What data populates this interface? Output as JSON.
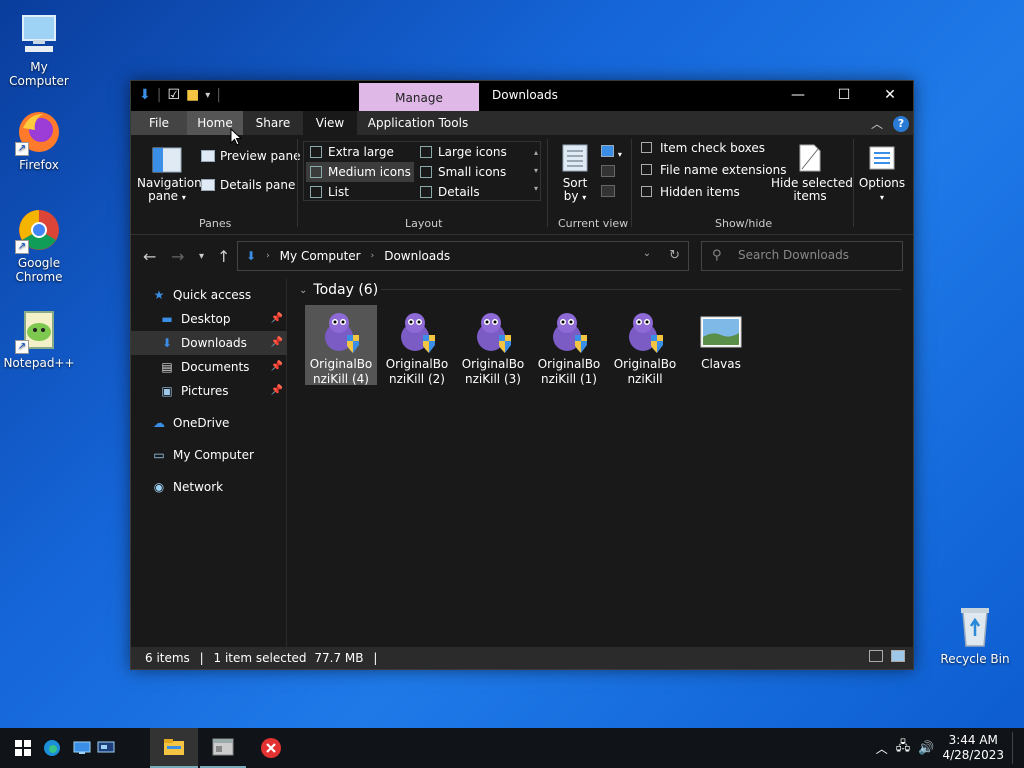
{
  "desktop": {
    "icons": [
      {
        "label": "My Computer"
      },
      {
        "label": "Firefox"
      },
      {
        "label": "Google Chrome"
      },
      {
        "label": "Notepad++"
      },
      {
        "label": "Recycle Bin"
      }
    ]
  },
  "window": {
    "title": "Downloads",
    "manage_tab": "Manage",
    "tabs": {
      "file": "File",
      "home": "Home",
      "share": "Share",
      "view": "View",
      "application_tools": "Application Tools"
    },
    "ribbon": {
      "panes": {
        "navigation_pane_line1": "Navigation",
        "navigation_pane_line2": "pane",
        "preview_pane": "Preview pane",
        "details_pane": "Details pane",
        "label": "Panes"
      },
      "layout": {
        "extra_large_icons": "Extra large icons",
        "large_icons": "Large icons",
        "medium_icons": "Medium icons",
        "small_icons": "Small icons",
        "list": "List",
        "details": "Details",
        "label": "Layout"
      },
      "current_view": {
        "sort_by_line1": "Sort",
        "sort_by_line2": "by",
        "label": "Current view"
      },
      "show_hide": {
        "item_check_boxes": "Item check boxes",
        "file_name_extensions": "File name extensions",
        "hidden_items": "Hidden items",
        "hide_selected_line1": "Hide selected",
        "hide_selected_line2": "items",
        "label": "Show/hide"
      },
      "options": "Options"
    },
    "address": {
      "crumbs": [
        "My Computer",
        "Downloads"
      ]
    },
    "search": {
      "placeholder": "Search Downloads"
    },
    "nav_pane": {
      "quick_access": "Quick access",
      "desktop": "Desktop",
      "downloads": "Downloads",
      "documents": "Documents",
      "pictures": "Pictures",
      "onedrive": "OneDrive",
      "my_computer": "My Computer",
      "network": "Network"
    },
    "content": {
      "group_header": "Today (6)",
      "files": [
        {
          "line1": "OriginalBo",
          "line2": "nziKill (4)"
        },
        {
          "line1": "OriginalBo",
          "line2": "nziKill (2)"
        },
        {
          "line1": "OriginalBo",
          "line2": "nziKill (3)"
        },
        {
          "line1": "OriginalBo",
          "line2": "nziKill (1)"
        },
        {
          "line1": "OriginalBo",
          "line2": "nziKill"
        },
        {
          "line1": "Clavas",
          "line2": ""
        }
      ]
    },
    "status": {
      "item_count": "6 items",
      "selection": "1 item selected",
      "size": "77.7 MB"
    }
  },
  "taskbar": {
    "time": "3:44 AM",
    "date": "4/28/2023"
  },
  "colors": {
    "manage_tab": "#e0b8e8",
    "window_bg": "#191919",
    "accent": "#2a7bd6"
  }
}
